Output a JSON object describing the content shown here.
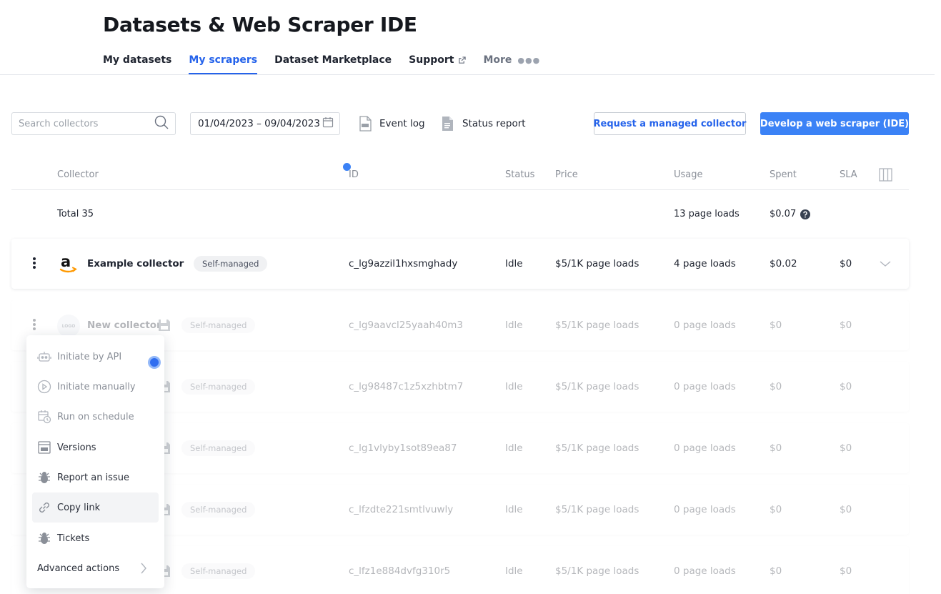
{
  "header": {
    "title": "Datasets & Web Scraper IDE"
  },
  "tabs": [
    {
      "label": "My datasets"
    },
    {
      "label": "My scrapers",
      "active": true
    },
    {
      "label": "Dataset Marketplace"
    },
    {
      "label": "Support",
      "icon": "external-link-icon"
    },
    {
      "label": "More",
      "icon": "more-dots-icon"
    }
  ],
  "toolbar": {
    "search_placeholder": "Search collectors",
    "date_range": "01/04/2023 – 09/04/2023",
    "event_log": "Event log",
    "status_report": "Status report",
    "request_managed": "Request a managed collector",
    "develop_ide": "Develop a web scraper (IDE)"
  },
  "columns": {
    "collector": "Collector",
    "id": "ID",
    "status": "Status",
    "price": "Price",
    "usage": "Usage",
    "spent": "Spent",
    "sla": "SLA"
  },
  "total": {
    "label": "Total 35",
    "usage": "13 page loads",
    "spent": "$0.07"
  },
  "rows": [
    {
      "name": "Example collector",
      "logo": "amazon-logo",
      "badge": "Self-managed",
      "id": "c_lg9azzil1hxsmghady",
      "status": "Idle",
      "price": "$5/1K page loads",
      "usage": "4 page loads",
      "spent": "$0.02",
      "sla": "$0"
    },
    {
      "name": "New collector",
      "logo": "LOGO",
      "badge": "Self-managed",
      "id": "c_lg9aavcl25yaah40m3",
      "status": "Idle",
      "price": "$5/1K page loads",
      "usage": "0 page loads",
      "spent": "$0",
      "sla": "$0"
    },
    {
      "name": "",
      "badge": "Self-managed",
      "id": "c_lg98487c1z5xzhbtm7",
      "status": "Idle",
      "price": "$5/1K page loads",
      "usage": "0 page loads",
      "spent": "$0",
      "sla": "$0"
    },
    {
      "name": "",
      "badge": "Self-managed",
      "id": "c_lg1vlyby1sot89ea87",
      "status": "Idle",
      "price": "$5/1K page loads",
      "usage": "0 page loads",
      "spent": "$0",
      "sla": "$0"
    },
    {
      "name": "",
      "badge": "Self-managed",
      "id": "c_lfzdte221smtlvuwly",
      "status": "Idle",
      "price": "$5/1K page loads",
      "usage": "0 page loads",
      "spent": "$0",
      "sla": "$0"
    },
    {
      "name": "",
      "badge": "Self-managed",
      "id": "c_lfz1e884dvfg310r5",
      "status": "Idle",
      "price": "$5/1K page loads",
      "usage": "0 page loads",
      "spent": "$0",
      "sla": "$0"
    }
  ],
  "menu": [
    {
      "label": "Initiate by API",
      "icon": "robot-icon",
      "disabled": true
    },
    {
      "label": "Initiate manually",
      "icon": "play-circle-icon",
      "disabled": true
    },
    {
      "label": "Run on schedule",
      "icon": "calendar-clock-icon",
      "disabled": true
    },
    {
      "label": "Versions",
      "icon": "versions-icon"
    },
    {
      "label": "Report an issue",
      "icon": "bug-icon"
    },
    {
      "label": "Copy link",
      "icon": "link-icon",
      "hovered": true
    },
    {
      "label": "Tickets",
      "icon": "bug-icon"
    },
    {
      "label": "Advanced actions",
      "icon": "chevron-right-icon"
    }
  ],
  "colors": {
    "accent": "#3b82f6",
    "accent_text": "#2563eb",
    "text": "#1f2430",
    "muted": "#8a8f98"
  }
}
